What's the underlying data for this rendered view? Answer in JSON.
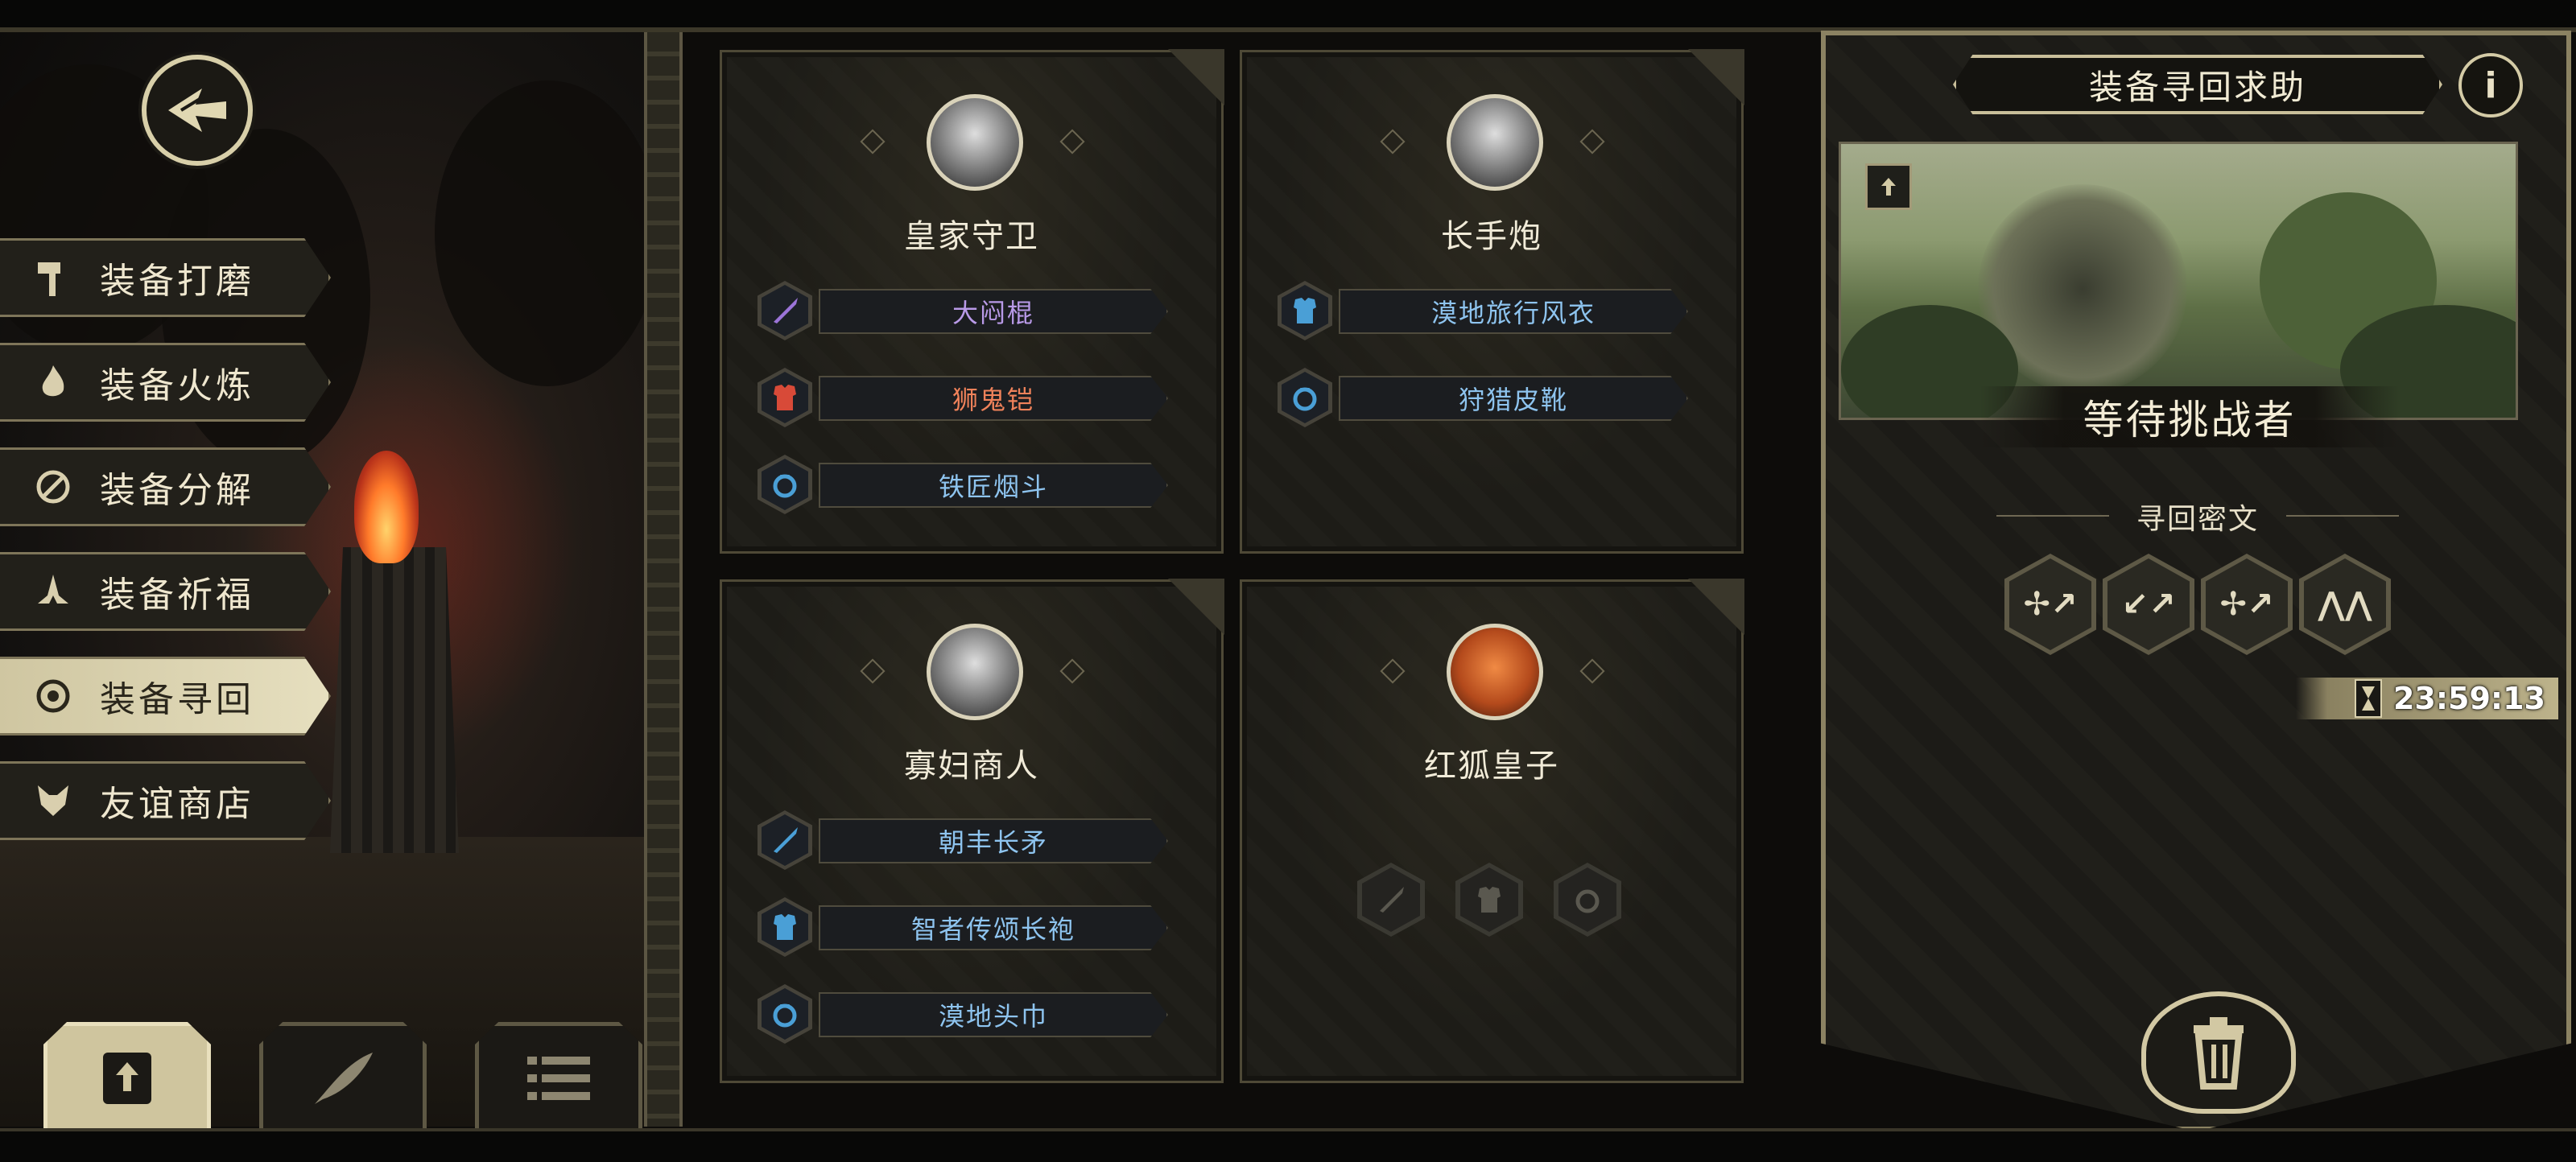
{
  "left_menu": {
    "items": [
      {
        "label": "装备打磨",
        "icon": "hammer-icon",
        "active": false
      },
      {
        "label": "装备火炼",
        "icon": "flame-icon",
        "active": false
      },
      {
        "label": "装备分解",
        "icon": "disassemble-icon",
        "active": false
      },
      {
        "label": "装备祈福",
        "icon": "pray-icon",
        "active": false
      },
      {
        "label": "装备寻回",
        "icon": "target-icon",
        "active": true
      },
      {
        "label": "友谊商店",
        "icon": "fox-icon",
        "active": false
      }
    ],
    "bottom_tabs": [
      {
        "icon": "export-icon",
        "active": true
      },
      {
        "icon": "feather-icon",
        "active": false
      },
      {
        "icon": "list-icon",
        "active": false
      }
    ]
  },
  "characters": [
    {
      "name": "皇家守卫",
      "equipment": [
        {
          "name": "大闷棍",
          "slot": "weapon",
          "color": "#b99ae8"
        },
        {
          "name": "狮鬼铠",
          "slot": "armor",
          "color": "#f0825a"
        },
        {
          "name": "铁匠烟斗",
          "slot": "accessory",
          "color": "#8ec4ef"
        }
      ]
    },
    {
      "name": "长手炮",
      "equipment": [
        {
          "name": "漠地旅行风衣",
          "slot": "armor",
          "color": "#8ec4ef"
        },
        {
          "name": "狩猎皮靴",
          "slot": "accessory",
          "color": "#8ec4ef"
        }
      ]
    },
    {
      "name": "寡妇商人",
      "equipment": [
        {
          "name": "朝丰长矛",
          "slot": "weapon",
          "color": "#8ec4ef"
        },
        {
          "name": "智者传颂长袍",
          "slot": "armor",
          "color": "#8ec4ef"
        },
        {
          "name": "漠地头巾",
          "slot": "accessory",
          "color": "#8ec4ef"
        }
      ]
    },
    {
      "name": "红狐皇子",
      "equipment": []
    }
  ],
  "panel": {
    "title": "装备寻回求助",
    "info": "i",
    "status": "等待挑战者",
    "cipher_label": "寻回密文",
    "cipher_runes": [
      "✢↗",
      "↙↗",
      "✢↗",
      "⋀⋀"
    ],
    "timer": "23:59:13"
  },
  "colors": {
    "panel_border": "#8b8262",
    "active_tab": "#cfc6a1",
    "rare_blue": "#8ec4ef",
    "epic_purple": "#b99ae8",
    "legendary_orange": "#f0825a"
  }
}
